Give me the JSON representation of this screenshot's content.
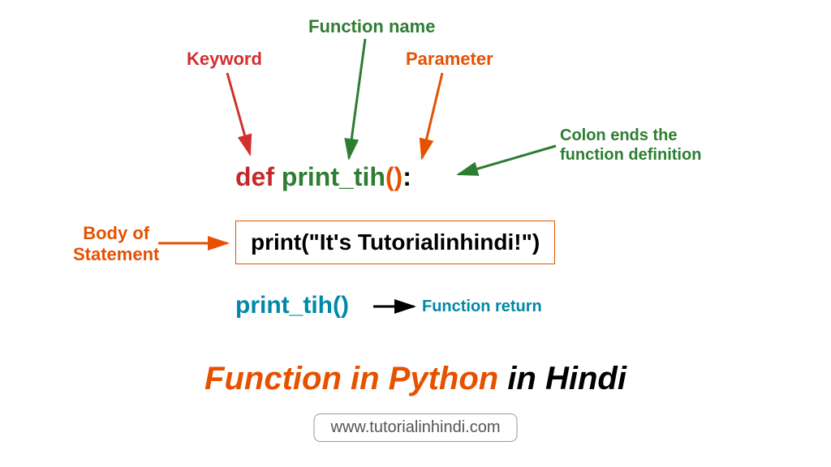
{
  "labels": {
    "keyword": "Keyword",
    "function_name": "Function name",
    "parameter": "Parameter",
    "colon_note": "Colon ends the\nfunction definition",
    "body": "Body of\nStatement",
    "return": "Function return"
  },
  "code": {
    "def": "def",
    "name": "print_tih",
    "parens": "()",
    "colon": ":",
    "body": "print(\"It's Tutorialinhindi!\")",
    "call": "print_tih()"
  },
  "title": {
    "part1": "Function in Python",
    "part2": " in Hindi"
  },
  "url": "www.tutorialinhindi.com",
  "colors": {
    "red": "#d32f2f",
    "green": "#2e7d32",
    "orange": "#e65100",
    "blue": "#0288a7"
  }
}
